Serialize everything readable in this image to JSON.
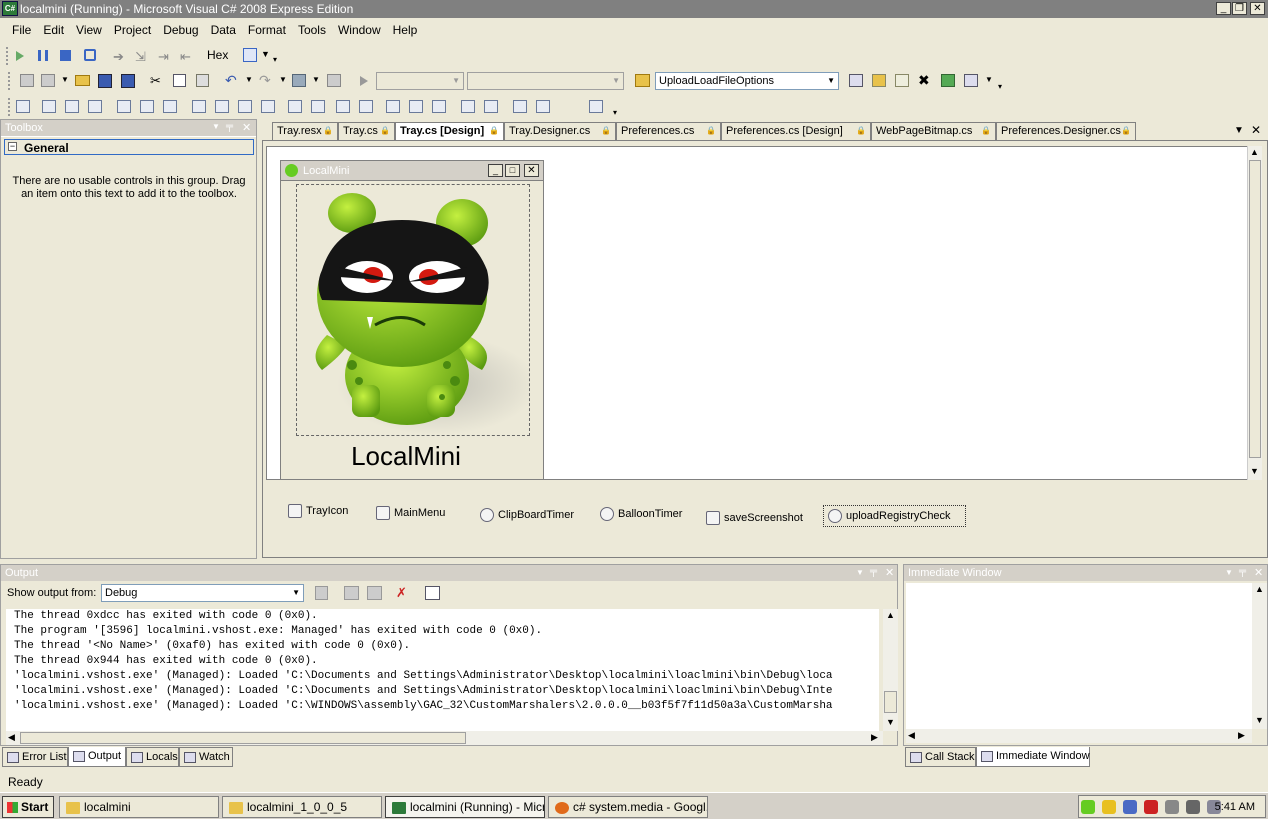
{
  "window": {
    "title": "localmini (Running) - Microsoft Visual C# 2008 Express Edition",
    "app_icon": "csharp-icon",
    "controls": [
      "minimize",
      "restore",
      "close"
    ]
  },
  "menu": {
    "items": [
      "File",
      "Edit",
      "View",
      "Project",
      "Debug",
      "Data",
      "Format",
      "Tools",
      "Window",
      "Help"
    ]
  },
  "toolbar1": {
    "hex_label": "Hex"
  },
  "toolbar2": {
    "startup_dropdown": "UploadLoadFileOptions"
  },
  "toolbox": {
    "title": "Toolbox",
    "group": "General",
    "empty_text": "There are no usable controls in this group. Drag an item onto this text to add it to the toolbox."
  },
  "doc_tabs": [
    {
      "label": "Tray.resx",
      "active": false
    },
    {
      "label": "Tray.cs",
      "active": false
    },
    {
      "label": "Tray.cs [Design]",
      "active": true
    },
    {
      "label": "Tray.Designer.cs",
      "active": false
    },
    {
      "label": "Preferences.cs",
      "active": false
    },
    {
      "label": "Preferences.cs [Design]",
      "active": false
    },
    {
      "label": "WebPageBitmap.cs",
      "active": false
    },
    {
      "label": "Preferences.Designer.cs",
      "active": false
    }
  ],
  "form": {
    "title": "LocalMini",
    "caption": "LocalMini"
  },
  "components": [
    {
      "label": "TrayIcon",
      "icon": "trayicon-icon"
    },
    {
      "label": "MainMenu",
      "icon": "menu-icon"
    },
    {
      "label": "ClipBoardTimer",
      "icon": "timer-icon"
    },
    {
      "label": "BalloonTimer",
      "icon": "timer-icon"
    },
    {
      "label": "saveScreenshot",
      "icon": "save-dialog-icon"
    },
    {
      "label": "uploadRegistryCheck",
      "icon": "timer-icon"
    }
  ],
  "output": {
    "title": "Output",
    "show_from_label": "Show output from:",
    "source": "Debug",
    "lines": [
      "The thread 0xdcc has exited with code 0 (0x0).",
      "The program '[3596] localmini.vshost.exe: Managed' has exited with code 0 (0x0).",
      "The thread '<No Name>' (0xaf0) has exited with code 0 (0x0).",
      "The thread 0x944 has exited with code 0 (0x0).",
      "'localmini.vshost.exe' (Managed): Loaded 'C:\\Documents and Settings\\Administrator\\Desktop\\localmini\\loaclmini\\bin\\Debug\\loca",
      "'localmini.vshost.exe' (Managed): Loaded 'C:\\Documents and Settings\\Administrator\\Desktop\\localmini\\loaclmini\\bin\\Debug\\Inte",
      "'localmini.vshost.exe' (Managed): Loaded 'C:\\WINDOWS\\assembly\\GAC_32\\CustomMarshalers\\2.0.0.0__b03f5f7f11d50a3a\\CustomMarsha"
    ]
  },
  "immediate": {
    "title": "Immediate Window"
  },
  "bottom_tabs_left": [
    "Error List",
    "Output",
    "Locals",
    "Watch"
  ],
  "bottom_tabs_right": [
    "Call Stack",
    "Immediate Window"
  ],
  "status": {
    "text": "Ready"
  },
  "taskbar": {
    "start": "Start",
    "tasks": [
      "localmini",
      "localmini_1_0_0_5",
      "localmini (Running) - Micr...",
      "c# system.media - Googl..."
    ],
    "clock": "5:41 AM"
  }
}
